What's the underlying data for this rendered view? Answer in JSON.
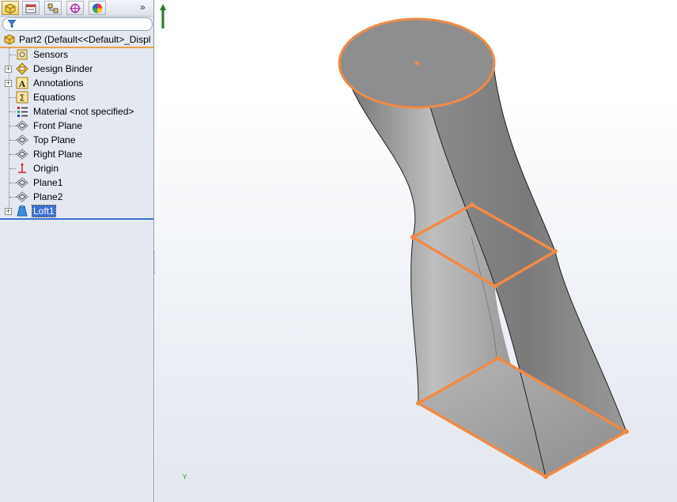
{
  "toolbar": {
    "buttons": [
      {
        "icon": "feature-manager-icon",
        "active": true
      },
      {
        "icon": "property-manager-icon",
        "active": false
      },
      {
        "icon": "configuration-manager-icon",
        "active": false
      },
      {
        "icon": "dimxpert-manager-icon",
        "active": false
      },
      {
        "icon": "display-manager-icon",
        "active": false
      }
    ],
    "more": "»"
  },
  "filter": {
    "icon": "filter-icon",
    "value": ""
  },
  "root": {
    "label": "Part2  (Default<<Default>_Displ",
    "icon": "part-icon"
  },
  "tree": [
    {
      "label": "Sensors",
      "icon": "sensors-icon",
      "expandable": false
    },
    {
      "label": "Design Binder",
      "icon": "design-binder-icon",
      "expandable": true
    },
    {
      "label": "Annotations",
      "icon": "annotations-icon",
      "expandable": true
    },
    {
      "label": "Equations",
      "icon": "equations-icon",
      "expandable": false
    },
    {
      "label": "Material <not specified>",
      "icon": "material-icon",
      "expandable": false
    },
    {
      "label": "Front Plane",
      "icon": "plane-icon",
      "expandable": false
    },
    {
      "label": "Top Plane",
      "icon": "plane-icon",
      "expandable": false
    },
    {
      "label": "Right Plane",
      "icon": "plane-icon",
      "expandable": false
    },
    {
      "label": "Origin",
      "icon": "origin-icon",
      "expandable": false
    },
    {
      "label": "Plane1",
      "icon": "plane-icon",
      "expandable": false
    },
    {
      "label": "Plane2",
      "icon": "plane-icon",
      "expandable": false
    },
    {
      "label": "Loft1",
      "icon": "loft-icon",
      "expandable": true,
      "selected": true
    }
  ],
  "graphics": {
    "triad_label": "Y",
    "highlight_color": "#f08a46",
    "body_color": "#8c8c8c"
  }
}
